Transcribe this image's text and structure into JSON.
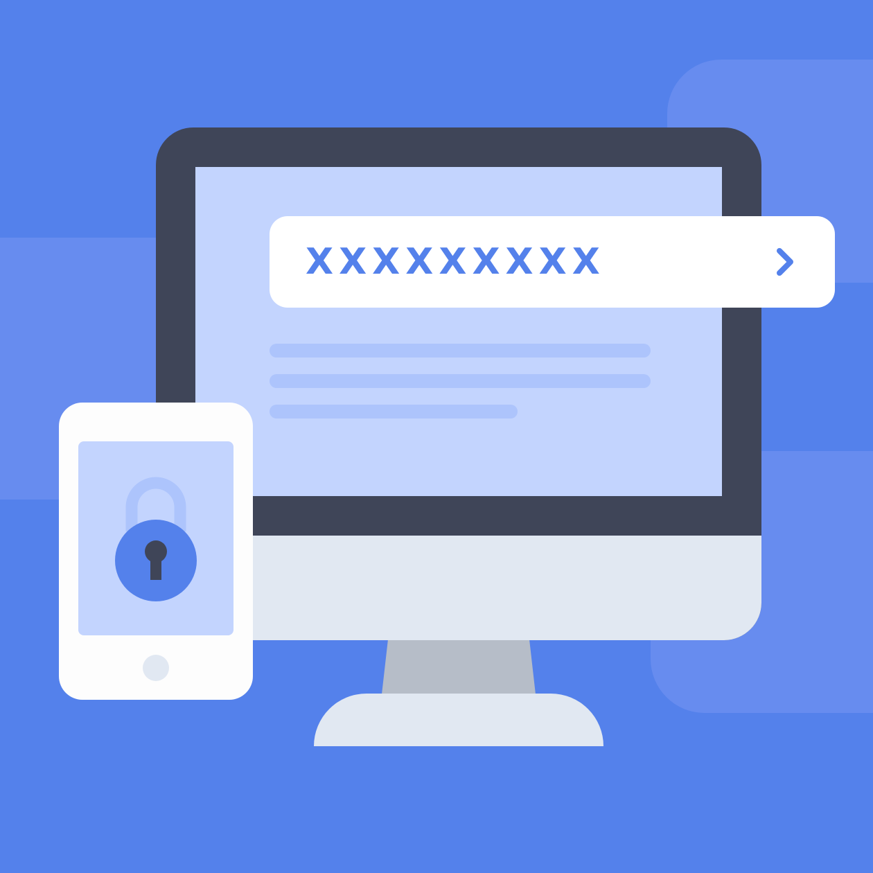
{
  "password_field": {
    "masked_value": "XXXXXXXXX",
    "submit_icon": "chevron-right-icon"
  },
  "phone": {
    "screen_icon": "padlock-icon"
  },
  "colors": {
    "background": "#5481eb",
    "background_tile": "#6b8ef0",
    "monitor_bezel": "#3f4558",
    "screen": "#c3d4fe",
    "text_placeholder": "#adc4fc",
    "accent": "#5481eb",
    "device_body": "#e1e8f2"
  }
}
